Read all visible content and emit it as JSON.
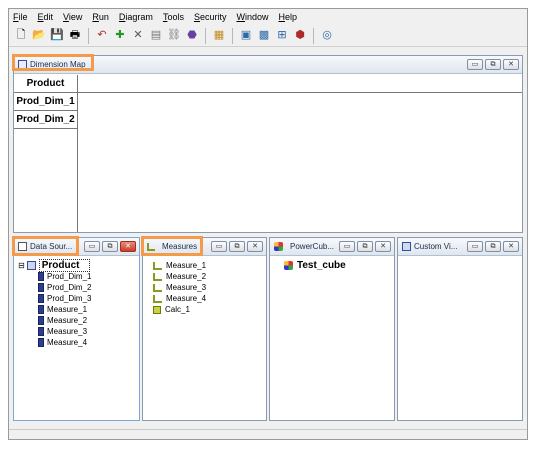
{
  "menu": [
    "File",
    "Edit",
    "View",
    "Run",
    "Diagram",
    "Tools",
    "Security",
    "Window",
    "Help"
  ],
  "toolbar_icons": [
    "new-icon",
    "open-icon",
    "save-icon",
    "print-icon",
    "undo-icon",
    "add-icon",
    "delete-icon",
    "grid-icon",
    "link-icon",
    "filter-icon",
    "chart-icon",
    "image-icon",
    "image-alt-icon",
    "cube-icon",
    "help-icon"
  ],
  "dimension_map": {
    "title": "Dimension Map",
    "header": "Product",
    "rows": [
      "Prod_Dim_1",
      "Prod_Dim_2"
    ]
  },
  "data_source": {
    "title": "Data Sour...",
    "root": "Product",
    "items": [
      "Prod_Dim_1",
      "Prod_Dim_2",
      "Prod_Dim_3",
      "Measure_1",
      "Measure_2",
      "Measure_3",
      "Measure_4"
    ]
  },
  "measures": {
    "title": "Measures",
    "items": [
      "Measure_1",
      "Measure_2",
      "Measure_3",
      "Measure_4"
    ],
    "calc": "Calc_1"
  },
  "powercube": {
    "title": "PowerCub...",
    "items": [
      "Test_cube"
    ]
  },
  "custom_views": {
    "title": "Custom Vi..."
  },
  "colors": {
    "highlight": "#f39a4b",
    "title_bar": "#dfe6ef"
  }
}
